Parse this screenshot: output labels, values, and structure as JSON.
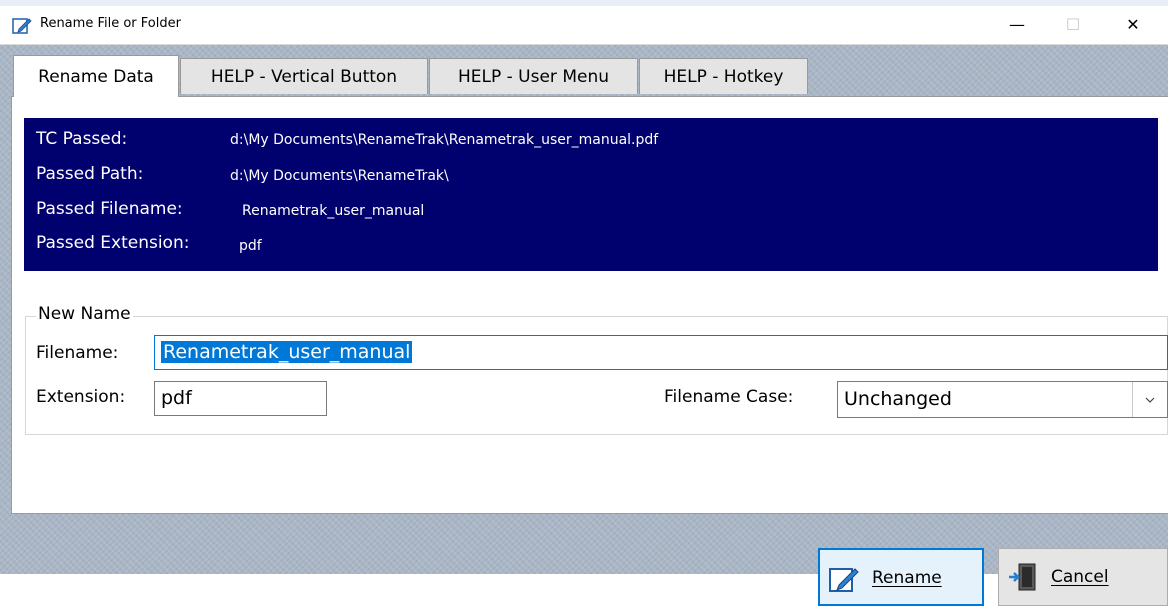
{
  "window": {
    "title": "Rename File or Folder",
    "minimize_glyph": "—",
    "maximize_glyph": "☐",
    "close_glyph": "✕"
  },
  "tabs": [
    {
      "label": "Rename Data",
      "active": true
    },
    {
      "label": "HELP - Vertical Button",
      "active": false
    },
    {
      "label": "HELP - User Menu",
      "active": false
    },
    {
      "label": "HELP - Hotkey",
      "active": false
    }
  ],
  "info": {
    "rows": [
      {
        "label": "TC Passed:",
        "value": "d:\\My Documents\\RenameTrak\\Renametrak_user_manual.pdf"
      },
      {
        "label": "Passed Path:",
        "value": "d:\\My Documents\\RenameTrak\\"
      },
      {
        "label": "Passed Filename:",
        "value": "Renametrak_user_manual"
      },
      {
        "label": "Passed Extension:",
        "value": "pdf"
      }
    ]
  },
  "new_name": {
    "legend": "New Name",
    "filename_label": "Filename:",
    "filename_value": "Renametrak_user_manual",
    "extension_label": "Extension:",
    "extension_value": "pdf",
    "case_label": "Filename Case:",
    "case_value": "Unchanged"
  },
  "buttons": {
    "rename_label": "Rename",
    "cancel_label": "Cancel"
  },
  "colors": {
    "info_background": "#00006e",
    "selection": "#0078d7"
  },
  "icons": {
    "app": "rename-pencil-icon",
    "rename_button": "rename-pencil-icon",
    "cancel_button": "exit-door-icon",
    "combo": "chevron-down-icon"
  }
}
